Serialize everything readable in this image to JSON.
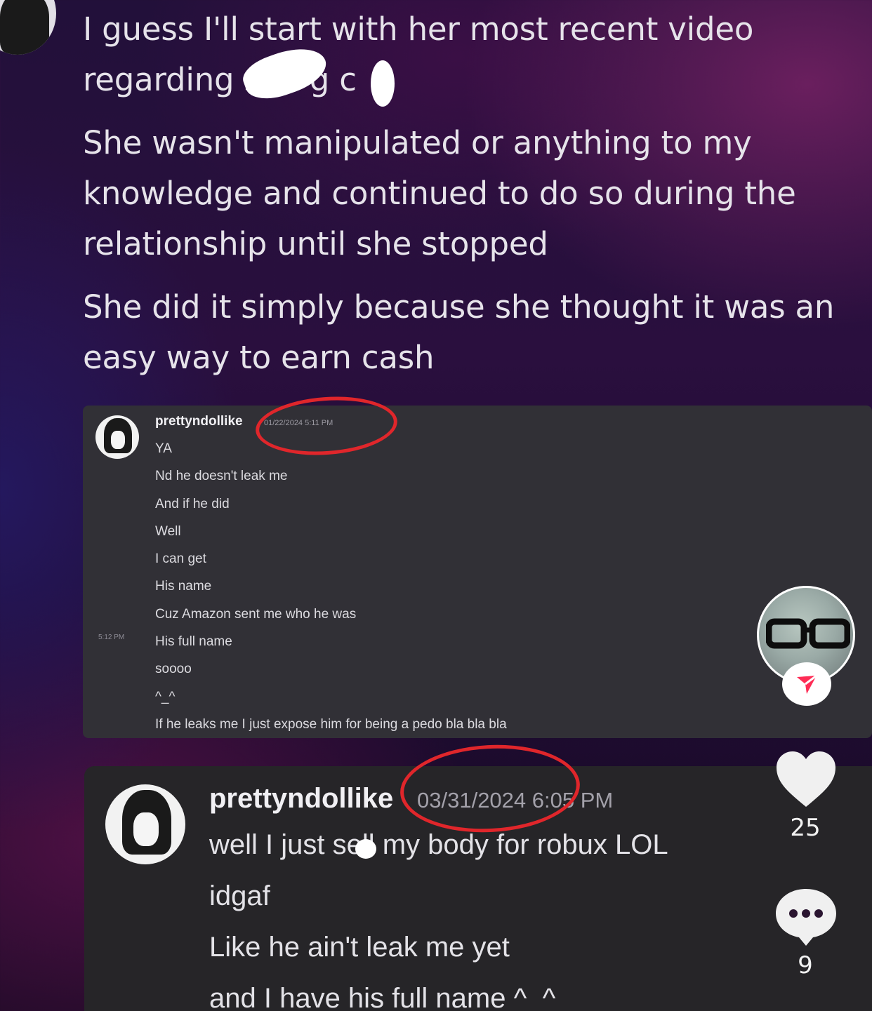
{
  "post": {
    "paragraph1": "I guess I'll start with her most recent video\nregarding s",
    "paragraph1_tail": "g c",
    "paragraph2": "She wasn't manipulated or anything to my\nknowledge and continued to do so during the\nrelationship until she stopped",
    "paragraph3": "She did it simply because she thought it was an\neasy way to earn cash"
  },
  "screenshot1": {
    "username": "prettyndollike",
    "timestamp": "01/22/2024 5:11 PM",
    "side_timestamp": "5:12 PM",
    "messages": [
      "YA",
      "Nd he doesn't leak me",
      "And if he did",
      "Well",
      "I can get",
      "His name",
      "Cuz Amazon sent me who he was",
      "His full name",
      "soooo",
      "^_^",
      "If he leaks me I just expose him for being a pedo bla bla bla"
    ]
  },
  "screenshot2": {
    "username": "prettyndollike",
    "timestamp": "03/31/2024 6:05 PM",
    "messages": [
      "well I just sell my body for robux LOL",
      "idgaf",
      "Like he ain't leak me yet",
      "and I have his full name ^_^"
    ]
  },
  "sidebar": {
    "like_count": "25",
    "comment_count": "9"
  },
  "colors": {
    "annotation_red": "#e0262b",
    "tiktok_red": "#fe2c55"
  },
  "icons": [
    "heart-icon",
    "comment-icon",
    "follow-plus-icon"
  ]
}
